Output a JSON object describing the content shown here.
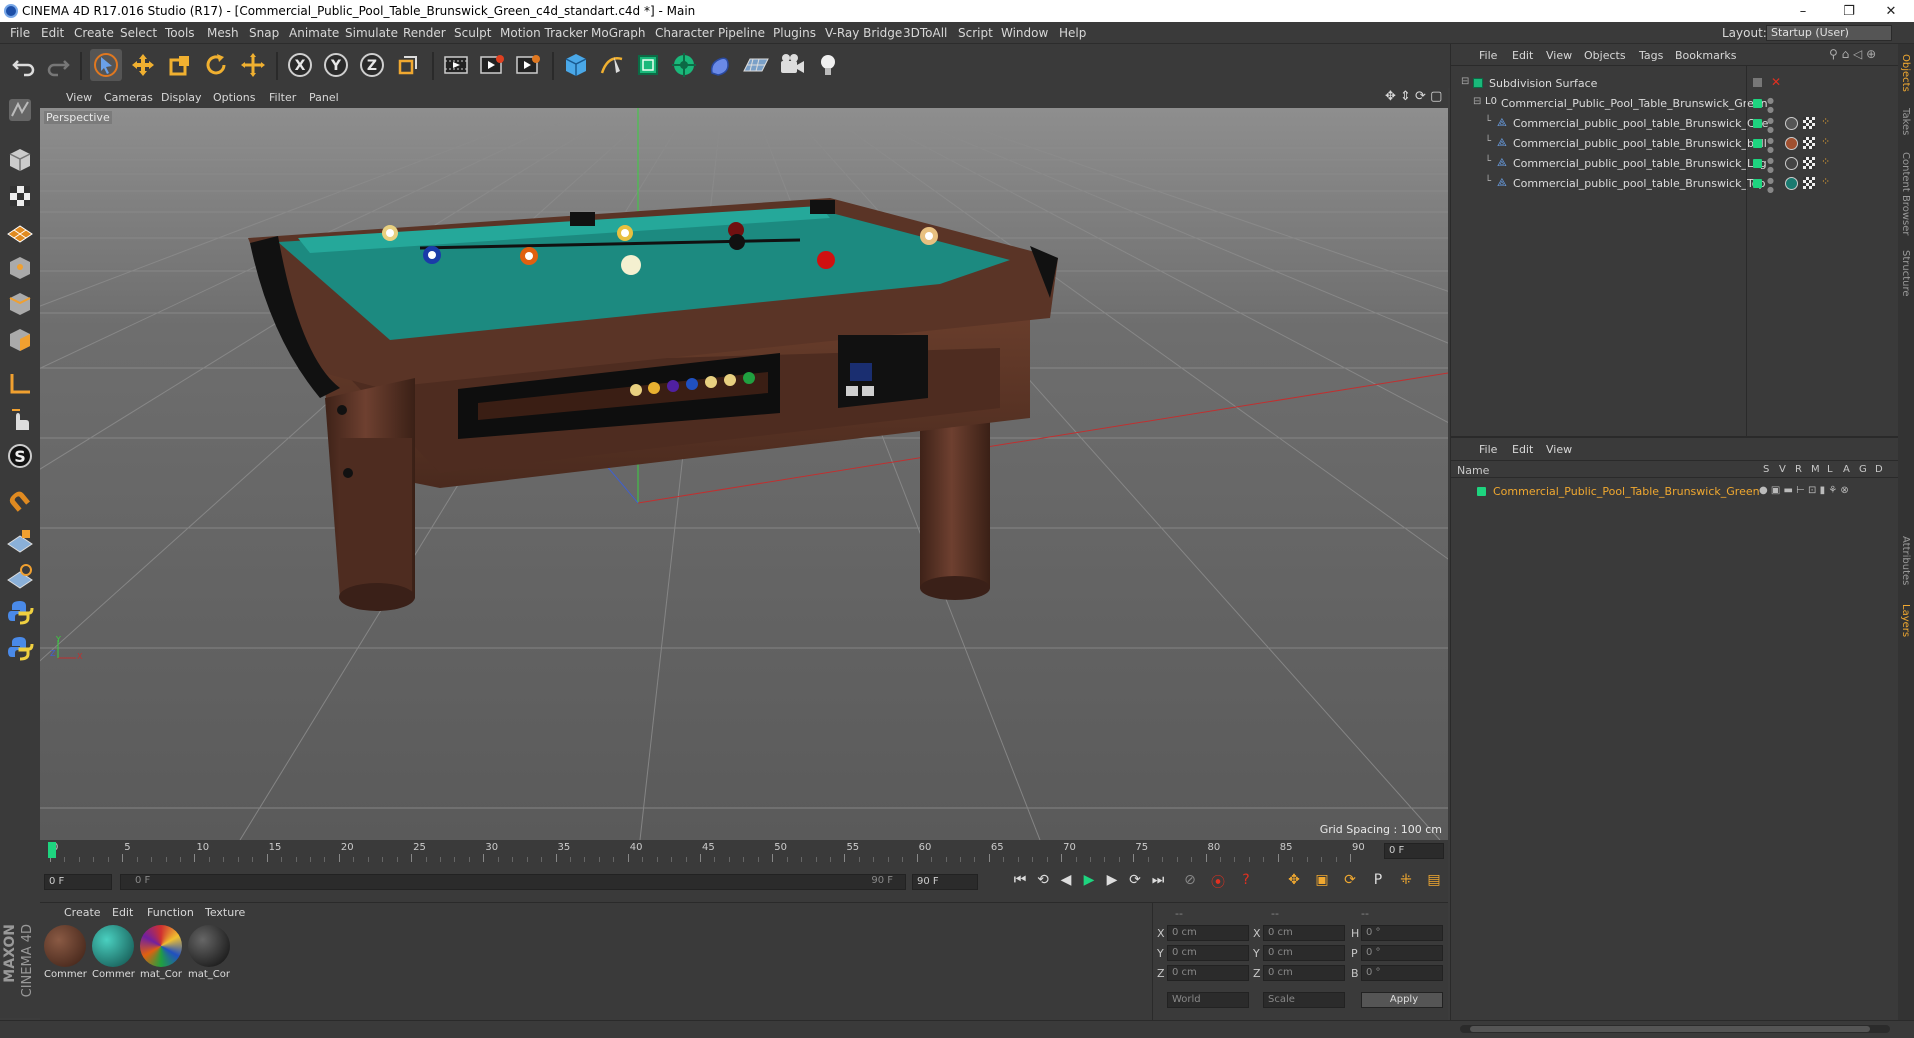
{
  "window": {
    "title": "CINEMA 4D R17.016 Studio (R17) - [Commercial_Public_Pool_Table_Brunswick_Green_c4d_standart.c4d *] - Main",
    "controls": [
      "–",
      "❐",
      "✕"
    ]
  },
  "menu": {
    "items": [
      "File",
      "Edit",
      "Create",
      "Select",
      "Tools",
      "Mesh",
      "Snap",
      "Animate",
      "Simulate",
      "Render",
      "Sculpt",
      "Motion Tracker",
      "MoGraph",
      "Character",
      "Pipeline",
      "Plugins",
      "V-Ray Bridge",
      "3DToAll",
      "Script",
      "Window",
      "Help"
    ],
    "layout_label": "Layout:",
    "layout_value": "Startup (User)"
  },
  "toolbar": {
    "icons": [
      "undo-icon",
      "redo-icon",
      "select-arrow-icon",
      "move-icon",
      "scale-icon",
      "rotate-icon",
      "live-select-icon",
      "x-axis-icon",
      "y-axis-icon",
      "z-axis-icon",
      "world-coord-icon",
      "render-view-icon",
      "render-picture-icon",
      "render-settings-icon",
      "cube-icon",
      "pen-icon",
      "subdivision-icon",
      "cloner-icon",
      "deformer-icon",
      "floor-icon",
      "camera-icon",
      "light-icon"
    ],
    "axis_labels": [
      "X",
      "Y",
      "Z"
    ]
  },
  "viewport": {
    "menu": [
      "View",
      "Cameras",
      "Display",
      "Options",
      "Filter",
      "Panel"
    ],
    "label": "Perspective",
    "grid_spacing": "Grid Spacing : 100 cm",
    "axis": {
      "x": "X",
      "y": "Y",
      "z": "Z"
    }
  },
  "timeline": {
    "ticks": [
      "0",
      "5",
      "10",
      "15",
      "20",
      "25",
      "30",
      "35",
      "40",
      "45",
      "50",
      "55",
      "60",
      "65",
      "70",
      "75",
      "80",
      "85",
      "90"
    ],
    "current_frame": "0 F",
    "current_position": 0.0
  },
  "playback": {
    "start_field": "0 F",
    "range_start": "0 F",
    "range_end": "90 F",
    "end_field": "90 F"
  },
  "materials": {
    "menu": [
      "Create",
      "Edit",
      "Function",
      "Texture"
    ],
    "items": [
      {
        "label": "Commer",
        "color": "#4a2a20"
      },
      {
        "label": "Commer",
        "color": "#1f6f6a"
      },
      {
        "label": "mat_Cor",
        "color": "#a03030"
      },
      {
        "label": "mat_Cor",
        "color": "#1a1a1a"
      }
    ]
  },
  "coords": {
    "headers": [
      "--",
      "--",
      "--"
    ],
    "rows": [
      {
        "a": "X",
        "av": "0 cm",
        "b": "X",
        "bv": "0 cm",
        "c": "H",
        "cv": "0 °"
      },
      {
        "a": "Y",
        "av": "0 cm",
        "b": "Y",
        "bv": "0 cm",
        "c": "P",
        "cv": "0 °"
      },
      {
        "a": "Z",
        "av": "0 cm",
        "b": "Z",
        "bv": "0 cm",
        "c": "B",
        "cv": "0 °"
      }
    ],
    "mode1": "World",
    "mode2": "Scale",
    "apply": "Apply"
  },
  "objects": {
    "menu": [
      "File",
      "Edit",
      "View",
      "Objects",
      "Tags",
      "Bookmarks"
    ],
    "tree": [
      {
        "name": "Subdivision Surface",
        "level": 0,
        "selected": false
      },
      {
        "name": "Commercial_Public_Pool_Table_Brunswick_Green",
        "level": 1,
        "selected": false
      },
      {
        "name": "Commercial_public_pool_table_Brunswick_Cue",
        "level": 2,
        "selected": false
      },
      {
        "name": "Commercial_public_pool_table_Brunswick_ball",
        "level": 2,
        "selected": false
      },
      {
        "name": "Commercial_public_pool_table_Brunswick_Leg",
        "level": 2,
        "selected": false
      },
      {
        "name": "Commercial_public_pool_table_Brunswick_Top",
        "level": 2,
        "selected": false
      }
    ]
  },
  "layers": {
    "menu": [
      "File",
      "Edit",
      "View"
    ],
    "col_name": "Name",
    "cols": [
      "S",
      "V",
      "R",
      "M",
      "L",
      "A",
      "G",
      "D"
    ],
    "rows": [
      {
        "name": "Commercial_Public_Pool_Table_Brunswick_Green",
        "color": "#1ed47f"
      }
    ]
  },
  "side_tabs": [
    "Objects",
    "Takes",
    "Content Browser",
    "Structure",
    "Attributes",
    "Layers"
  ],
  "branding": {
    "maxon": "MAXON",
    "product": "CINEMA 4D"
  },
  "colors": {
    "accent": "#1ed47f",
    "highlight": "#f0a830"
  }
}
